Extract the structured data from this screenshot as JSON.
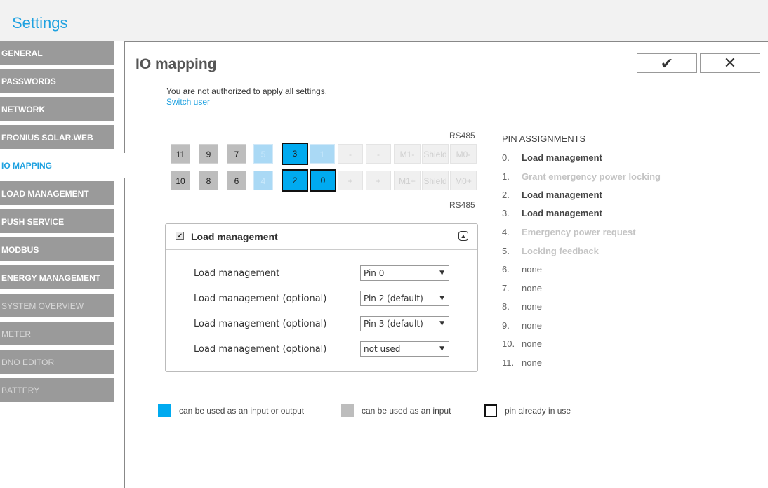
{
  "app": {
    "title": "Settings"
  },
  "sidebar": {
    "items": [
      {
        "label": "GENERAL"
      },
      {
        "label": "PASSWORDS"
      },
      {
        "label": "NETWORK"
      },
      {
        "label": "FRONIUS SOLAR.WEB"
      },
      {
        "label": "IO MAPPING"
      },
      {
        "label": "LOAD MANAGEMENT"
      },
      {
        "label": "PUSH SERVICE"
      },
      {
        "label": "MODBUS"
      },
      {
        "label": "ENERGY MANAGEMENT"
      },
      {
        "label": "SYSTEM OVERVIEW"
      },
      {
        "label": "METER"
      },
      {
        "label": "DNO EDITOR"
      },
      {
        "label": "BATTERY"
      }
    ],
    "active": "IO MAPPING"
  },
  "page": {
    "title": "IO mapping",
    "ok_icon": "✔",
    "cancel_icon": "✕",
    "auth_message": "You are not authorized to apply all settings.",
    "switch_user": "Switch user"
  },
  "pins": {
    "rs485_top": "RS485",
    "rs485_bottom": "RS485",
    "top_row": [
      "11",
      "9",
      "7",
      "5",
      "3",
      "1",
      "-",
      "-",
      "M1-",
      "Shield",
      "M0-"
    ],
    "bottom_row": [
      "10",
      "8",
      "6",
      "4",
      "2",
      "0",
      "+",
      "+",
      "M1+",
      "Shield",
      "M0+"
    ]
  },
  "pin_assignments": {
    "title": "PIN ASSIGNMENTS",
    "rows": [
      {
        "num": "0.",
        "value": "Load management"
      },
      {
        "num": "1.",
        "value": "Grant emergency power locking"
      },
      {
        "num": "2.",
        "value": "Load management"
      },
      {
        "num": "3.",
        "value": "Load management"
      },
      {
        "num": "4.",
        "value": "Emergency power request"
      },
      {
        "num": "5.",
        "value": "Locking feedback"
      },
      {
        "num": "6.",
        "value": "none"
      },
      {
        "num": "7.",
        "value": "none"
      },
      {
        "num": "8.",
        "value": "none"
      },
      {
        "num": "9.",
        "value": "none"
      },
      {
        "num": "10.",
        "value": "none"
      },
      {
        "num": "11.",
        "value": "none"
      }
    ]
  },
  "load_management": {
    "title": "Load management",
    "checked": true,
    "check_glyph": "✔",
    "collapse_glyph": "▲",
    "rows": [
      {
        "label": "Load management",
        "value": "Pin 0"
      },
      {
        "label": "Load management (optional)",
        "value": "Pin 2 (default)"
      },
      {
        "label": "Load management (optional)",
        "value": "Pin 3 (default)"
      },
      {
        "label": "Load management (optional)",
        "value": "not used"
      }
    ],
    "arrow": "▼"
  },
  "legend": {
    "io": "can be used as an input or output",
    "input": "can be used as an input",
    "in_use": "pin already in use",
    "colors": {
      "io": "#00aaf0",
      "input": "#bdbdbd",
      "in_use_border": "#111111"
    }
  }
}
